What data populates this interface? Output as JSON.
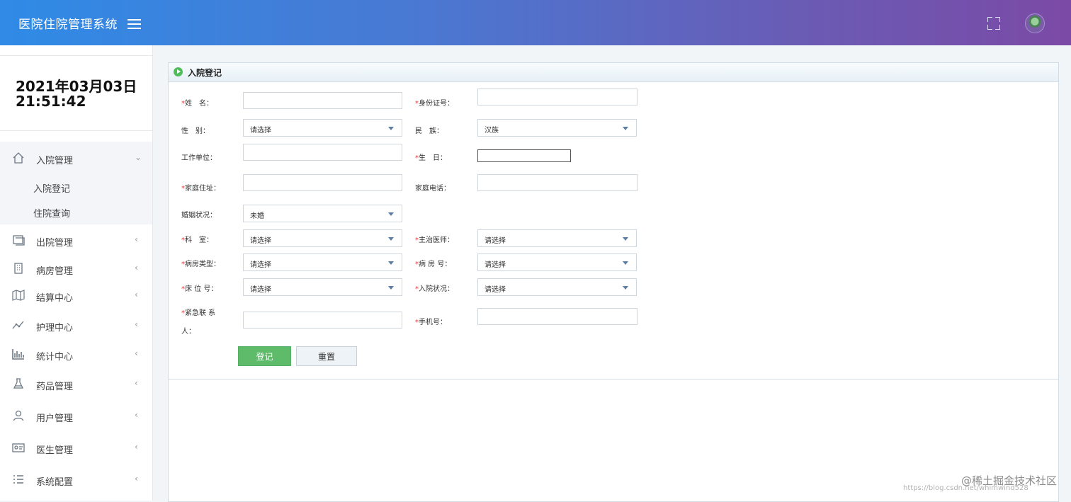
{
  "header": {
    "title": "医院住院管理系统"
  },
  "sidebar": {
    "date": "2021年03月03日",
    "time": "21:51:42",
    "menu": [
      {
        "label": "入院管理",
        "icon": "home-icon",
        "expanded": true,
        "children": [
          "入院登记",
          "住院查询"
        ]
      },
      {
        "label": "出院管理",
        "icon": "discharge-icon"
      },
      {
        "label": "病房管理",
        "icon": "building-icon"
      },
      {
        "label": "结算中心",
        "icon": "map-icon"
      },
      {
        "label": "护理中心",
        "icon": "line-chart-icon"
      },
      {
        "label": "统计中心",
        "icon": "bar-chart-icon"
      },
      {
        "label": "药品管理",
        "icon": "flask-icon"
      },
      {
        "label": "用户管理",
        "icon": "user-icon"
      },
      {
        "label": "医生管理",
        "icon": "id-card-icon"
      },
      {
        "label": "系统配置",
        "icon": "list-icon"
      }
    ]
  },
  "panel": {
    "title": "入院登记"
  },
  "form": {
    "req": "*",
    "name_label": "姓　名：",
    "id_label": "身份证号：",
    "gender_label": "性　别：",
    "gender_value": "请选择",
    "ethnic_label": "民　族：",
    "ethnic_value": "汉族",
    "work_label": "工作单位：",
    "birthday_label": "生　日：",
    "address_label": "家庭住址：",
    "phone_label": "家庭电话：",
    "marital_label": "婚姻状况：",
    "marital_value": "未婚",
    "dept_label": "科　室：",
    "dept_value": "请选择",
    "doctor_label": "主治医师：",
    "doctor_value": "请选择",
    "ward_type_label": "病房类型：",
    "ward_type_value": "请选择",
    "ward_no_label": "病 房 号：",
    "ward_no_value": "请选择",
    "bed_label": "床 位 号：",
    "bed_value": "请选择",
    "condition_label": "入院状况：",
    "condition_value": "请选择",
    "contact_label_1": "紧急联 系",
    "contact_label_2": "人：",
    "mobile_label": "手机号：",
    "submit": "登记",
    "reset": "重置"
  },
  "watermark": {
    "text": "@稀土掘金技术社区",
    "url": "https://blog.csdn.net/whimwind528"
  },
  "colors": {
    "header_start": "#2f8be6",
    "header_end": "#7b4aa6",
    "submit_green": "#5ebb6a",
    "required_red": "#e23a3a"
  }
}
